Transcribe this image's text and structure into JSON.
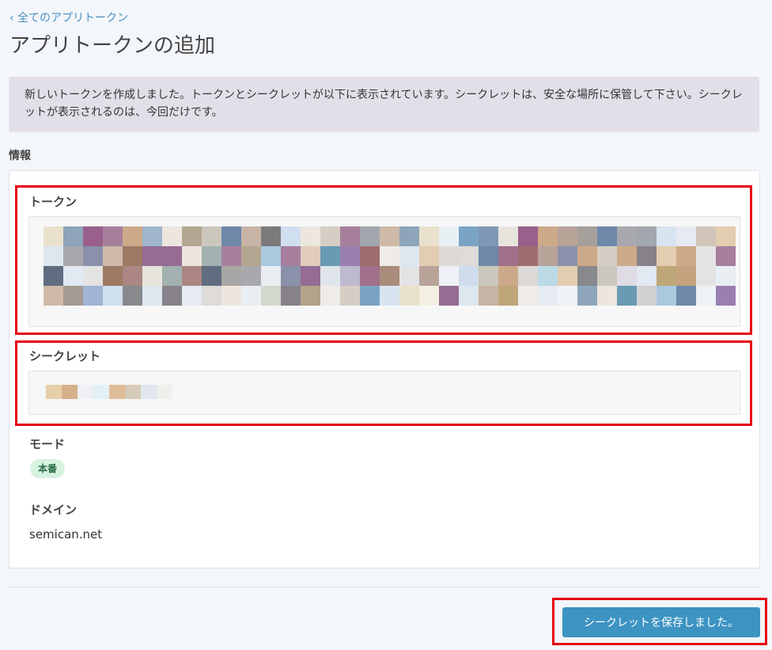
{
  "nav": {
    "back_label": "‹ 全てのアプリトークン"
  },
  "page": {
    "title": "アプリトークンの追加"
  },
  "notice": {
    "text": "新しいトークンを作成しました。トークンとシークレットが以下に表示されています。シークレットは、安全な場所に保管して下さい。シークレットが表示されるのは、今回だけです。"
  },
  "info": {
    "section_label": "情報",
    "token_label": "トークン",
    "secret_label": "シークレット",
    "mode_label": "モード",
    "mode_badge": "本番",
    "domain_label": "ドメイン",
    "domain_value": "semican.net"
  },
  "actions": {
    "save_label": "シークレットを保存しました。"
  },
  "colors": {
    "accent": "#3d93c2",
    "link": "#4a90c2",
    "highlight": "#e60012",
    "badge_bg": "#d6f2e1",
    "notice_bg": "#e3dfe9"
  }
}
